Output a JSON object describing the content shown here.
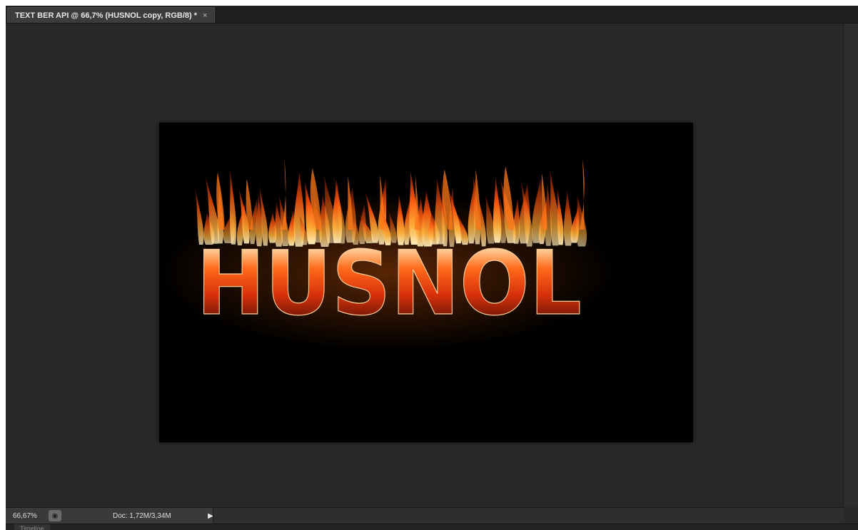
{
  "document_tab": {
    "title": "TEXT BER API @ 66,7% (HUSNOL copy, RGB/8) *",
    "close_glyph": "×"
  },
  "canvas": {
    "text": "HUSNOL",
    "text_colors": {
      "flame_tip": "#ffe9a8",
      "flame_mid": "#ff7a1a",
      "letter_top": "#ffd5a0",
      "letter_mid": "#d9320b",
      "letter_bottom": "#2a0400"
    },
    "background": "#000000"
  },
  "statusbar": {
    "zoom": "66,67%",
    "zoom_icon": "page-setup-icon",
    "doc_info": "Doc: 1,72M/3,34M",
    "menu_arrow": "▶"
  },
  "timeline": {
    "label": "Timeline"
  }
}
